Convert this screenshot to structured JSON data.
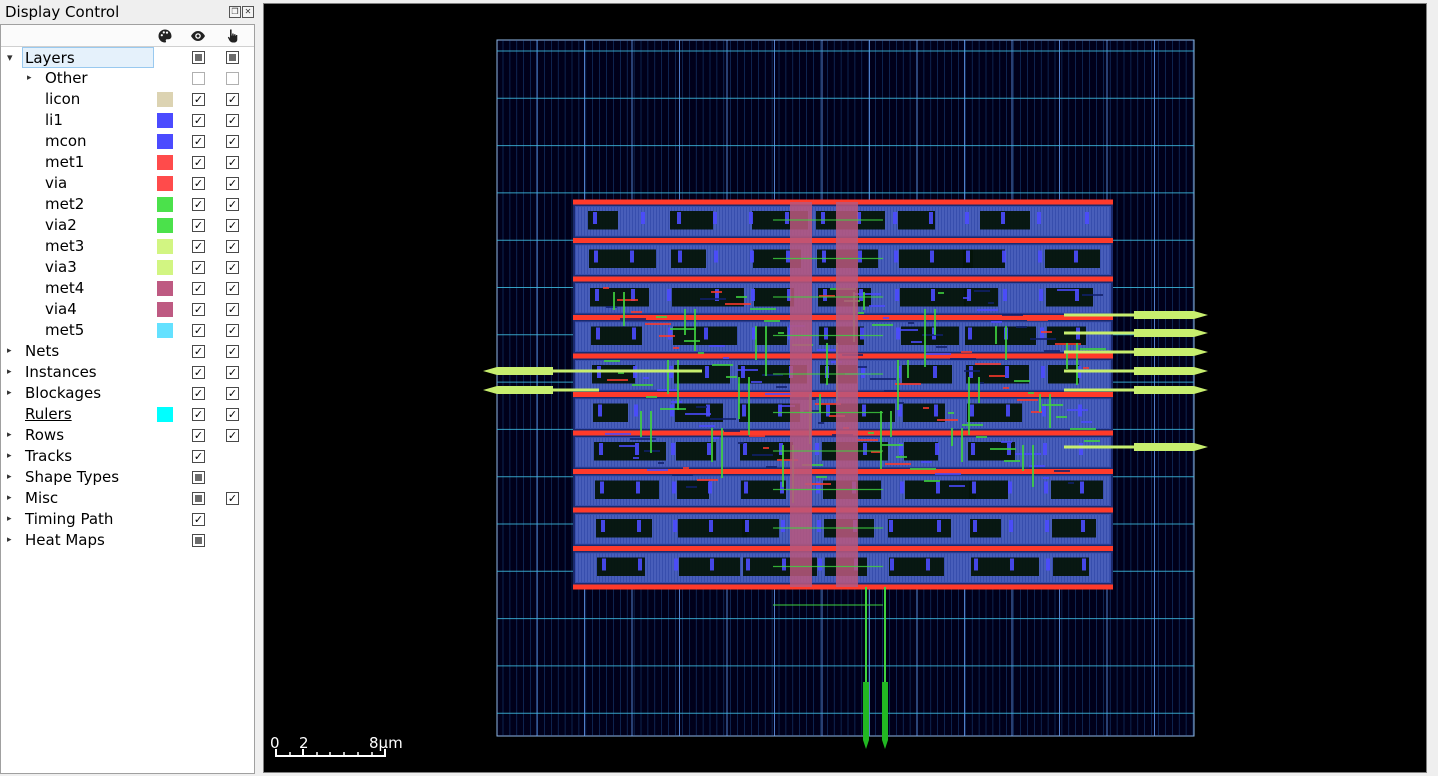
{
  "dock": {
    "title": "Display Control",
    "float_icon": "float-icon",
    "close_icon": "close-icon",
    "header_icons": [
      "palette-icon",
      "eye-icon",
      "pointer-hand-icon"
    ]
  },
  "tree": [
    {
      "label": "Layers",
      "indent": 0,
      "expand": "open",
      "color": null,
      "visible": "partial",
      "selectable": "partial",
      "selected": true
    },
    {
      "label": "Other",
      "indent": 1,
      "expand": "closed",
      "color": null,
      "visible": "off",
      "selectable": "off"
    },
    {
      "label": "licon",
      "indent": 1,
      "expand": null,
      "color": "#dcd3b2",
      "visible": "on",
      "selectable": "on"
    },
    {
      "label": "li1",
      "indent": 1,
      "expand": null,
      "color": "#4b4bff",
      "visible": "on",
      "selectable": "on"
    },
    {
      "label": "mcon",
      "indent": 1,
      "expand": null,
      "color": "#4b4bff",
      "visible": "on",
      "selectable": "on"
    },
    {
      "label": "met1",
      "indent": 1,
      "expand": null,
      "color": "#ff4b4b",
      "visible": "on",
      "selectable": "on"
    },
    {
      "label": "via",
      "indent": 1,
      "expand": null,
      "color": "#ff4b4b",
      "visible": "on",
      "selectable": "on"
    },
    {
      "label": "met2",
      "indent": 1,
      "expand": null,
      "color": "#4be14b",
      "visible": "on",
      "selectable": "on"
    },
    {
      "label": "via2",
      "indent": 1,
      "expand": null,
      "color": "#4be14b",
      "visible": "on",
      "selectable": "on"
    },
    {
      "label": "met3",
      "indent": 1,
      "expand": null,
      "color": "#d2f582",
      "visible": "on",
      "selectable": "on"
    },
    {
      "label": "via3",
      "indent": 1,
      "expand": null,
      "color": "#d2f582",
      "visible": "on",
      "selectable": "on"
    },
    {
      "label": "met4",
      "indent": 1,
      "expand": null,
      "color": "#be5a82",
      "visible": "on",
      "selectable": "on"
    },
    {
      "label": "via4",
      "indent": 1,
      "expand": null,
      "color": "#be5a82",
      "visible": "on",
      "selectable": "on"
    },
    {
      "label": "met5",
      "indent": 1,
      "expand": null,
      "color": "#64e1ff",
      "visible": "on",
      "selectable": "on"
    },
    {
      "label": "Nets",
      "indent": 0,
      "expand": "closed",
      "color": null,
      "visible": "on",
      "selectable": "on"
    },
    {
      "label": "Instances",
      "indent": 0,
      "expand": "closed",
      "color": null,
      "visible": "on",
      "selectable": "on"
    },
    {
      "label": "Blockages",
      "indent": 0,
      "expand": "closed",
      "color": null,
      "visible": "on",
      "selectable": "on"
    },
    {
      "label": "Rulers",
      "indent": 0,
      "expand": null,
      "color": "#00ffff",
      "visible": "on",
      "selectable": "on",
      "underline": true
    },
    {
      "label": "Rows",
      "indent": 0,
      "expand": "closed",
      "color": null,
      "visible": "on",
      "selectable": "on"
    },
    {
      "label": "Tracks",
      "indent": 0,
      "expand": "closed",
      "color": null,
      "visible": "on",
      "selectable": null
    },
    {
      "label": "Shape Types",
      "indent": 0,
      "expand": "closed",
      "color": null,
      "visible": "partial",
      "selectable": null
    },
    {
      "label": "Misc",
      "indent": 0,
      "expand": "closed",
      "color": null,
      "visible": "partial",
      "selectable": "on"
    },
    {
      "label": "Timing Path",
      "indent": 0,
      "expand": "closed",
      "color": null,
      "visible": "on",
      "selectable": null
    },
    {
      "label": "Heat Maps",
      "indent": 0,
      "expand": "closed",
      "color": null,
      "visible": "partial",
      "selectable": null
    }
  ],
  "scale_bar": {
    "ticks": [
      "0",
      "2",
      "8μm"
    ]
  },
  "layout_colors": {
    "background": "#000000",
    "die": "#4a8fcf",
    "tracks": "#2b6fc0",
    "rails": "#ff3a2a",
    "met4": "#b8587e",
    "met2": "#3fd43f",
    "met3": "#c7ee6e",
    "li1": "#4b4bff"
  }
}
